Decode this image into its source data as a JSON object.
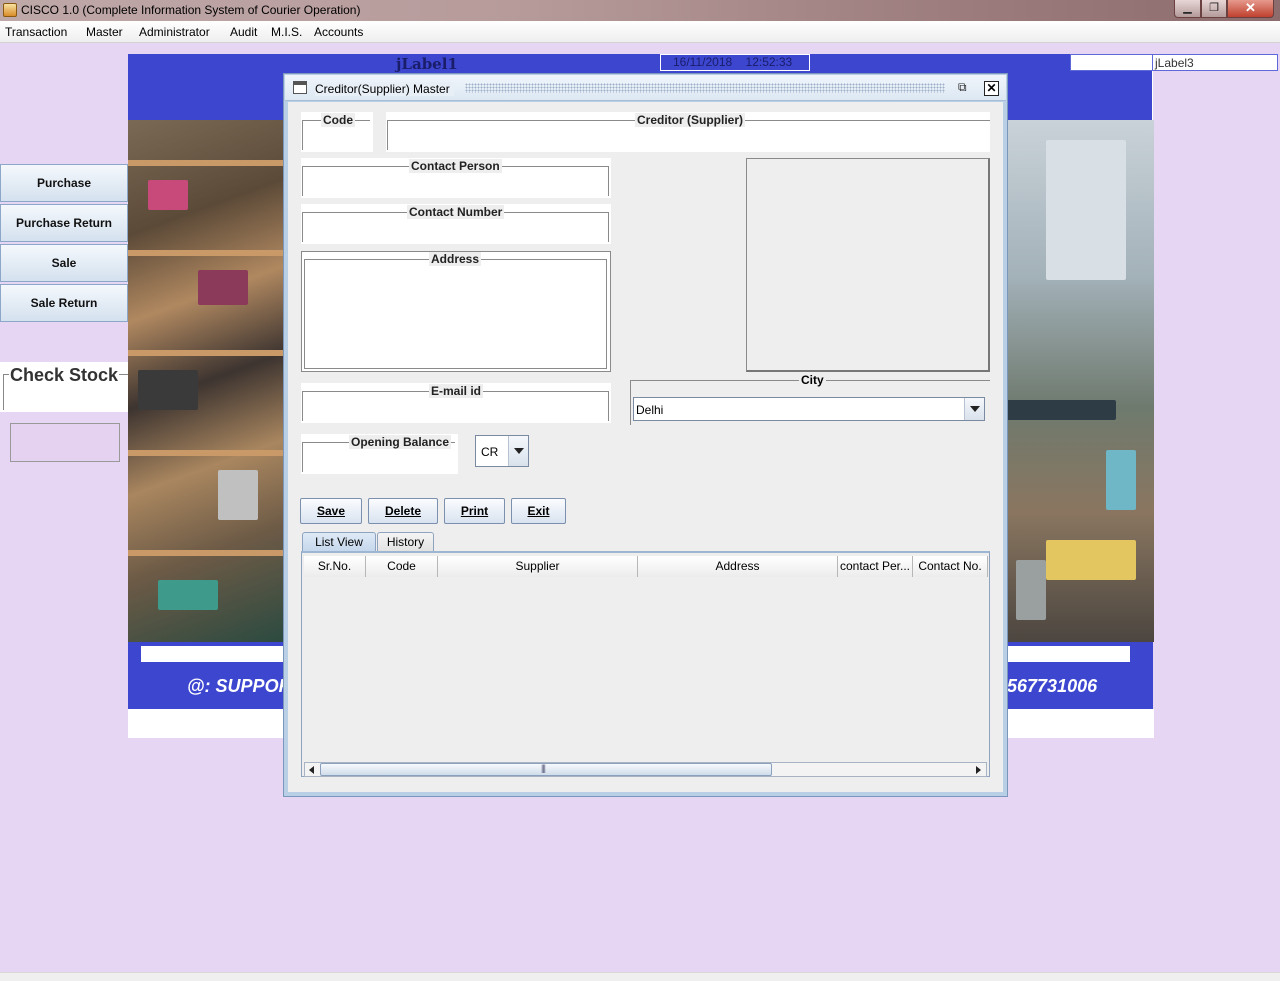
{
  "app": {
    "window_title": "CISCO 1.0 (Complete Information System of Courier Operation)",
    "min_glyph": "▁",
    "max_glyph": "❐",
    "close_glyph": "✕"
  },
  "menu": [
    "Transaction",
    "Master",
    "Administrator",
    "Audit",
    "M.I.S.",
    "Accounts"
  ],
  "side_buttons": [
    "Purchase",
    "Purchase Return",
    "Sale",
    "Sale Return"
  ],
  "check_stock_label": "Check Stock",
  "header": {
    "jlabel1": "jLabel1",
    "date": "16/11/2018",
    "time": "12:52:33",
    "jlabel3": "jLabel3"
  },
  "footer": {
    "support_text": "@: SUPPOR",
    "phone_text": "567731006"
  },
  "form": {
    "title": "Creditor(Supplier) Master",
    "restore_glyph": "⧉",
    "close_glyph": "✕",
    "fields": {
      "code": {
        "label": "Code",
        "value": ""
      },
      "creditor": {
        "label": "Creditor (Supplier)",
        "value": ""
      },
      "contact_person": {
        "label": "Contact Person",
        "value": ""
      },
      "contact_number": {
        "label": "Contact Number",
        "value": ""
      },
      "address": {
        "label": "Address",
        "value": ""
      },
      "email": {
        "label": "E-mail id",
        "value": ""
      },
      "opening_balance": {
        "label": "Opening Balance",
        "value": ""
      }
    },
    "city": {
      "label": "City",
      "value": "Delhi"
    },
    "balance_type": {
      "value": "CR"
    },
    "buttons": [
      "Save",
      "Delete",
      "Print",
      "Exit"
    ],
    "tabs": [
      {
        "label": "List View",
        "active": true
      },
      {
        "label": "History",
        "active": false
      }
    ],
    "table": {
      "columns": [
        "Sr.No.",
        "Code",
        "Supplier",
        "Address",
        "contact Per...",
        "Contact No."
      ],
      "rows": []
    }
  },
  "colors": {
    "desktop_bg": "#e6d5f3",
    "banner_blue": "#3c46cf",
    "frame_border": "#b8cfe6"
  }
}
